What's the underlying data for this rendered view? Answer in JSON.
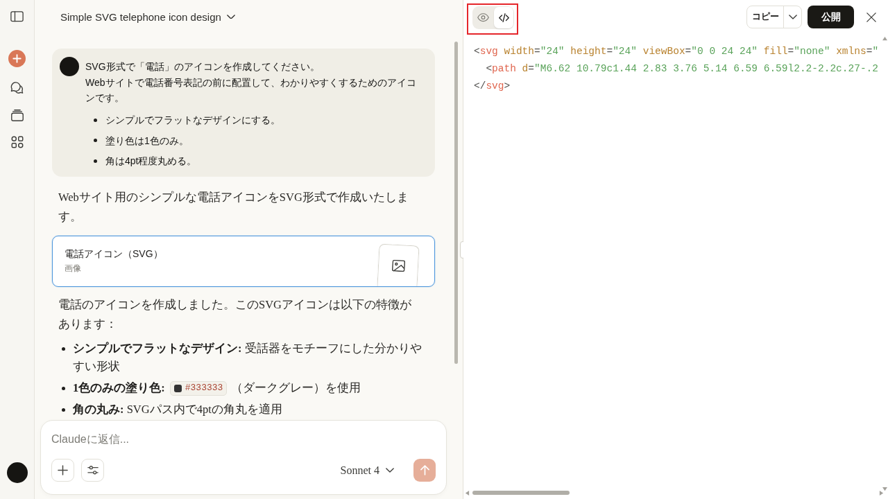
{
  "conversation": {
    "title": "Simple SVG telephone icon design"
  },
  "user_message": {
    "paragraphs": [
      "SVG形式で「電話」のアイコンを作成してください。",
      "Webサイトで電話番号表記の前に配置して、わかりやすくするためのアイコンです。"
    ],
    "bullets": [
      "シンプルでフラットなデザインにする。",
      "塗り色は1色のみ。",
      "角は4pt程度丸める。"
    ]
  },
  "assistant_message": {
    "blocks": [
      {
        "kind": "paragraph",
        "text": "Webサイト用のシンプルな電話アイコンをSVG形式で作成いたします。"
      },
      {
        "kind": "artifact",
        "title": "電話アイコン（SVG）",
        "subtitle": "画像",
        "selected": true
      },
      {
        "kind": "paragraph",
        "text": "電話のアイコンを作成しました。このSVGアイコンは以下の特徴があります："
      },
      {
        "kind": "list",
        "items": [
          {
            "term": "シンプルでフラットなデザイン:",
            "text": "受話器をモチーフにした分かりやすい形状"
          },
          {
            "term": "1色のみの塗り色:",
            "color_code": {
              "color": "#333333",
              "label": "#333333"
            },
            "text": "（ダークグレー）を使用"
          },
          {
            "term": "角の丸み:",
            "text": "SVGパス内で4ptの角丸を適用"
          }
        ]
      }
    ]
  },
  "composer": {
    "placeholder": "Claudeに返信...",
    "model": "Sonnet 4",
    "send_disabled": true
  },
  "artifact_panel": {
    "view_toggle": {
      "highlighted": true,
      "options": [
        {
          "kind": "preview",
          "selected": false
        },
        {
          "kind": "code",
          "selected": true
        }
      ]
    },
    "copy_label": "コピー",
    "publish_label": "公開",
    "code_lines": [
      [
        {
          "kind": "punct",
          "text": "<"
        },
        {
          "kind": "tag",
          "text": "svg"
        },
        {
          "kind": "attr",
          "text": " width"
        },
        {
          "kind": "punct",
          "text": "="
        },
        {
          "kind": "string",
          "text": "\"24\""
        },
        {
          "kind": "attr",
          "text": " height"
        },
        {
          "kind": "punct",
          "text": "="
        },
        {
          "kind": "string",
          "text": "\"24\""
        },
        {
          "kind": "attr",
          "text": " viewBox"
        },
        {
          "kind": "punct",
          "text": "="
        },
        {
          "kind": "string",
          "text": "\"0 0 24 24\""
        },
        {
          "kind": "attr",
          "text": " fill"
        },
        {
          "kind": "punct",
          "text": "="
        },
        {
          "kind": "string",
          "text": "\"none\""
        },
        {
          "kind": "attr",
          "text": " xmlns"
        },
        {
          "kind": "punct",
          "text": "="
        },
        {
          "kind": "string",
          "text": "\""
        }
      ],
      [
        {
          "kind": "punct",
          "text": "  <"
        },
        {
          "kind": "tag",
          "text": "path"
        },
        {
          "kind": "attr",
          "text": " d"
        },
        {
          "kind": "punct",
          "text": "="
        },
        {
          "kind": "string",
          "text": "\"M6.62 10.79c1.44 2.83 3.76 5.14 6.59 6.59l2.2-2.2c.27-.2"
        }
      ],
      [
        {
          "kind": "punct",
          "text": "</"
        },
        {
          "kind": "tag",
          "text": "svg"
        },
        {
          "kind": "punct",
          "text": ">"
        }
      ]
    ]
  }
}
